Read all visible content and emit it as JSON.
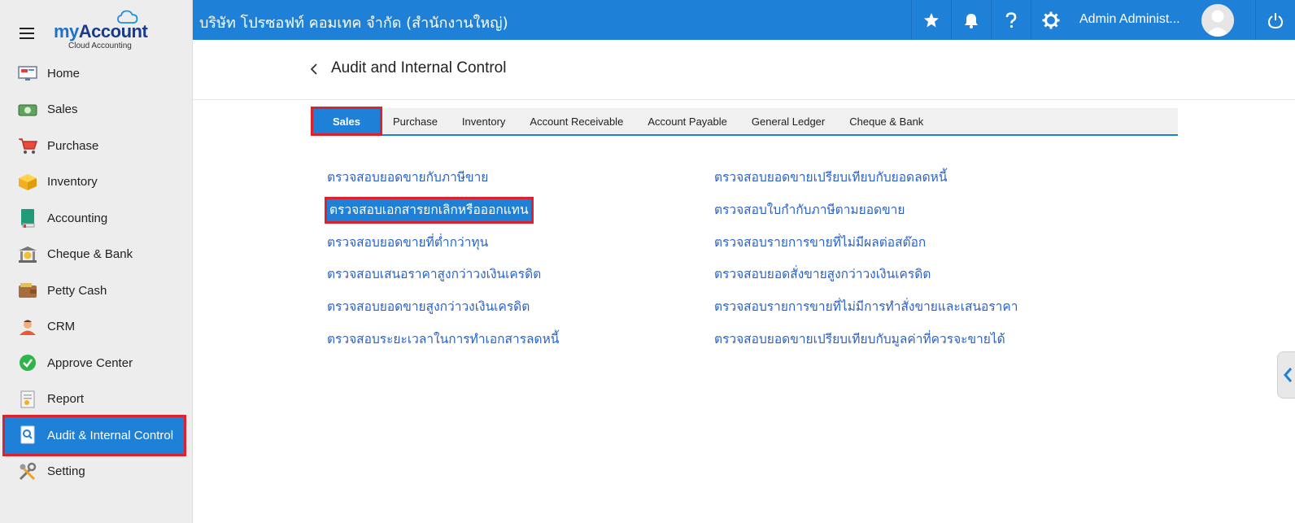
{
  "logo": {
    "brand_my": "my",
    "brand_account": "Account",
    "tagline": "Cloud Accounting"
  },
  "sidebar": {
    "items": [
      {
        "label": "Home",
        "icon": "home-icon"
      },
      {
        "label": "Sales",
        "icon": "sales-icon"
      },
      {
        "label": "Purchase",
        "icon": "cart-icon"
      },
      {
        "label": "Inventory",
        "icon": "box-icon"
      },
      {
        "label": "Accounting",
        "icon": "ledger-book-icon"
      },
      {
        "label": "Cheque & Bank",
        "icon": "bank-icon"
      },
      {
        "label": "Petty Cash",
        "icon": "wallet-icon"
      },
      {
        "label": "CRM",
        "icon": "person-icon"
      },
      {
        "label": "Approve Center",
        "icon": "check-circle-icon"
      },
      {
        "label": "Report",
        "icon": "report-icon"
      },
      {
        "label": "Audit & Internal Control",
        "icon": "audit-icon",
        "active": true
      },
      {
        "label": "Setting",
        "icon": "tools-icon"
      }
    ]
  },
  "header": {
    "company": "บริษัท โปรซอฟท์ คอมเทค จำกัด (สำนักงานใหญ่)",
    "user": "Admin Administ...",
    "buttons": [
      "star-icon",
      "bell-icon",
      "help-icon",
      "gear-icon",
      "power-icon"
    ]
  },
  "page": {
    "title": "Audit and Internal Control"
  },
  "tabs": [
    "Sales",
    "Purchase",
    "Inventory",
    "Account Receivable",
    "Account Payable",
    "General Ledger",
    "Cheque & Bank"
  ],
  "active_tab": "Sales",
  "links": {
    "left": [
      "ตรวจสอบยอดขายกับภาษีขาย",
      "ตรวจสอบเอกสารยกเลิกหรือออกแทน",
      "ตรวจสอบยอดขายที่ต่ำกว่าทุน",
      "ตรวจสอบเสนอราคาสูงกว่าวงเงินเครดิต",
      "ตรวจสอบยอดขายสูงกว่าวงเงินเครดิต",
      "ตรวจสอบระยะเวลาในการทำเอกสารลดหนี้"
    ],
    "right": [
      "ตรวจสอบยอดขายเปรียบเทียบกับยอดลดหนี้",
      "ตรวจสอบใบกำกับภาษีตามยอดขาย",
      "ตรวจสอบรายการขายที่ไม่มีผลต่อสต๊อก",
      "ตรวจสอบยอดสั่งขายสูงกว่าวงเงินเครดิต",
      "ตรวจสอบรายการขายที่ไม่มีการทำสั่งขายและเสนอราคา",
      "ตรวจสอบยอดขายเปรียบเทียบกับมูลค่าที่ควรจะขายได้"
    ],
    "selected": "ตรวจสอบเอกสารยกเลิกหรือออกแทน"
  },
  "colors": {
    "primary": "#1e80d6",
    "highlight": "#e0202a",
    "link": "#2a62c9",
    "sidebar_bg": "#ededed"
  }
}
